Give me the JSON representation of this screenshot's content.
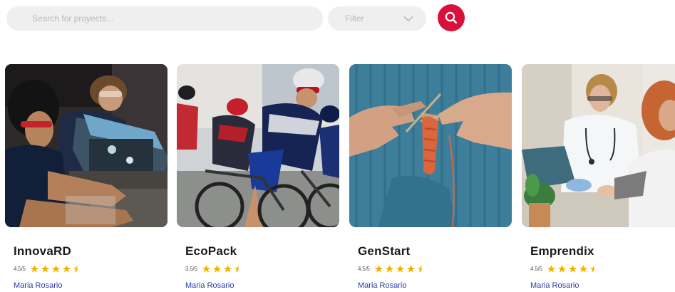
{
  "search": {
    "placeholder": "Search for proyects..."
  },
  "filter": {
    "label": "Filter",
    "icon": "chevron-down-icon"
  },
  "search_button": {
    "icon": "search-icon",
    "color": "#d8103a"
  },
  "star_color": "#f5b301",
  "author_color": "#2b3aa8",
  "projects": [
    {
      "title": "InnovaRD",
      "rating_text": "4.5/5",
      "rating": 4.5,
      "author": "Maria Rosario",
      "image": "robotics-students-photo"
    },
    {
      "title": "EcoPack",
      "rating_text": "3.5/5",
      "rating": 3.5,
      "author": "Maria Rosario",
      "image": "cyclists-race-photo"
    },
    {
      "title": "GenStart",
      "rating_text": "4.5/5",
      "rating": 4.5,
      "author": "Maria Rosario",
      "image": "knitting-hands-photo"
    },
    {
      "title": "Emprendix",
      "rating_text": "4.5/5",
      "rating": 4.5,
      "author": "Maria Rosario",
      "image": "doctor-patient-photo"
    }
  ]
}
